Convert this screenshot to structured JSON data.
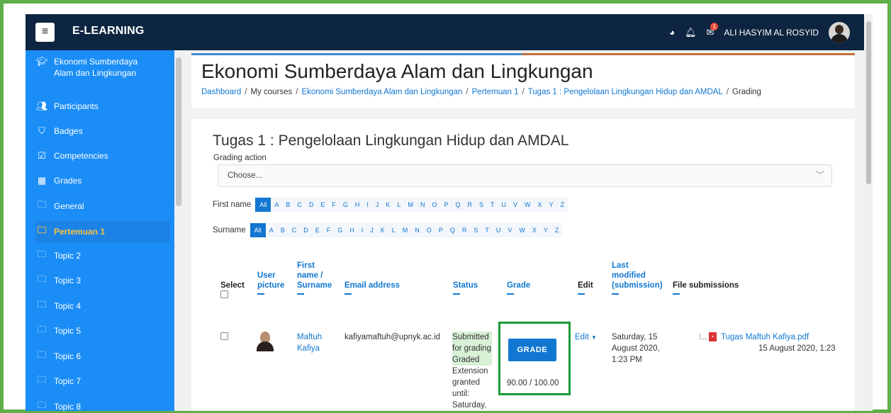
{
  "navbar": {
    "menu_icon": "hamburger-icon",
    "site_name": "E-LEARNING",
    "user_name": "ALI HASYIM AL ROSYID",
    "message_count": "1"
  },
  "sidebar": {
    "items": [
      {
        "label": "Ekonomi Sumberdaya Alam dan Lingkungan",
        "icon": "graduation-cap-icon"
      },
      {
        "label": "Participants",
        "icon": "users-icon"
      },
      {
        "label": "Badges",
        "icon": "shield-icon"
      },
      {
        "label": "Competencies",
        "icon": "checkbox-icon"
      },
      {
        "label": "Grades",
        "icon": "table-icon"
      },
      {
        "label": "General",
        "icon": "folder-icon"
      },
      {
        "label": "Pertemuan 1",
        "icon": "folder-icon"
      },
      {
        "label": "Topic 2",
        "icon": "folder-icon"
      },
      {
        "label": "Topic 3",
        "icon": "folder-icon"
      },
      {
        "label": "Topic 4",
        "icon": "folder-icon"
      },
      {
        "label": "Topic 5",
        "icon": "folder-icon"
      },
      {
        "label": "Topic 6",
        "icon": "folder-icon"
      },
      {
        "label": "Topic 7",
        "icon": "folder-icon"
      },
      {
        "label": "Topic 8",
        "icon": "folder-icon"
      }
    ]
  },
  "header": {
    "title": "Ekonomi Sumberdaya Alam dan Lingkungan",
    "breadcrumb": [
      "Dashboard",
      "My courses",
      "Ekonomi Sumberdaya Alam dan Lingkungan",
      "Pertemuan 1",
      "Tugas 1 : Pengelolaan Lingkungan Hidup dan AMDAL",
      "Grading"
    ]
  },
  "assignment": {
    "title": "Tugas 1 : Pengelolaan Lingkungan Hidup dan AMDAL",
    "grading_action_label": "Grading action",
    "grading_action_value": "Choose...",
    "first_name_label": "First name",
    "surname_label": "Surname",
    "all_label": "All",
    "letters": [
      "A",
      "B",
      "C",
      "D",
      "E",
      "F",
      "G",
      "H",
      "I",
      "J",
      "K",
      "L",
      "M",
      "N",
      "O",
      "P",
      "Q",
      "R",
      "S",
      "T",
      "U",
      "V",
      "W",
      "X",
      "Y",
      "Z"
    ]
  },
  "table": {
    "headers": {
      "select": "Select",
      "user_picture": "User picture",
      "name": "First name / Surname",
      "email": "Email address",
      "status": "Status",
      "grade": "Grade",
      "edit": "Edit",
      "last_modified": "Last modified (submission)",
      "file_submissions": "File submissions"
    },
    "row": {
      "first_name": "Maftuh",
      "surname": "Kafiya",
      "email": "kafiyamaftuh@upnyk.ac.id",
      "status_submitted": "Submitted for grading",
      "status_graded": "Graded",
      "status_extension": "Extension granted until: Saturday,",
      "grade_button": "GRADE",
      "grade_value": "90.00 / 100.00",
      "edit_label": "Edit",
      "last_modified": "Saturday, 15 August 2020, 1:23 PM",
      "file_name": "Tugas Maftuh Kafiya.pdf",
      "file_date": "15 August 2020, 1:23"
    }
  }
}
